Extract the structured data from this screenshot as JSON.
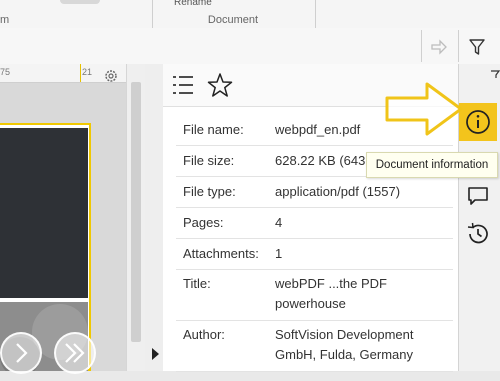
{
  "ribbon": {
    "cutoff_label": "Rename",
    "group_label": "Document",
    "left_label": "m"
  },
  "ruler": {
    "left_tick": "75",
    "right_tick": "21"
  },
  "info_panel": {
    "rows": [
      {
        "key": "File name:",
        "value": "webpdf_en.pdf"
      },
      {
        "key": "File size:",
        "value": "628.22 KB (643"
      },
      {
        "key": "File type:",
        "value": "application/pdf (1557)"
      },
      {
        "key": "Pages:",
        "value": "4"
      },
      {
        "key": "Attachments:",
        "value": "1"
      },
      {
        "key": "Title:",
        "value": "webPDF ...the PDF powerhouse"
      },
      {
        "key": "Author:",
        "value": "SoftVision Development GmbH, Fulda, Germany"
      }
    ]
  },
  "tooltip": {
    "text": "Document information"
  },
  "icons": {
    "list": "list-icon",
    "star": "star-icon",
    "info": "info-icon",
    "comment": "comment-icon",
    "history": "history-icon",
    "filter": "filter-icon",
    "arrow": "arrow-right-icon",
    "gear": "gear-icon"
  },
  "colors": {
    "accent_yellow": "#f3c41c",
    "callout_yellow": "#f0c419"
  }
}
